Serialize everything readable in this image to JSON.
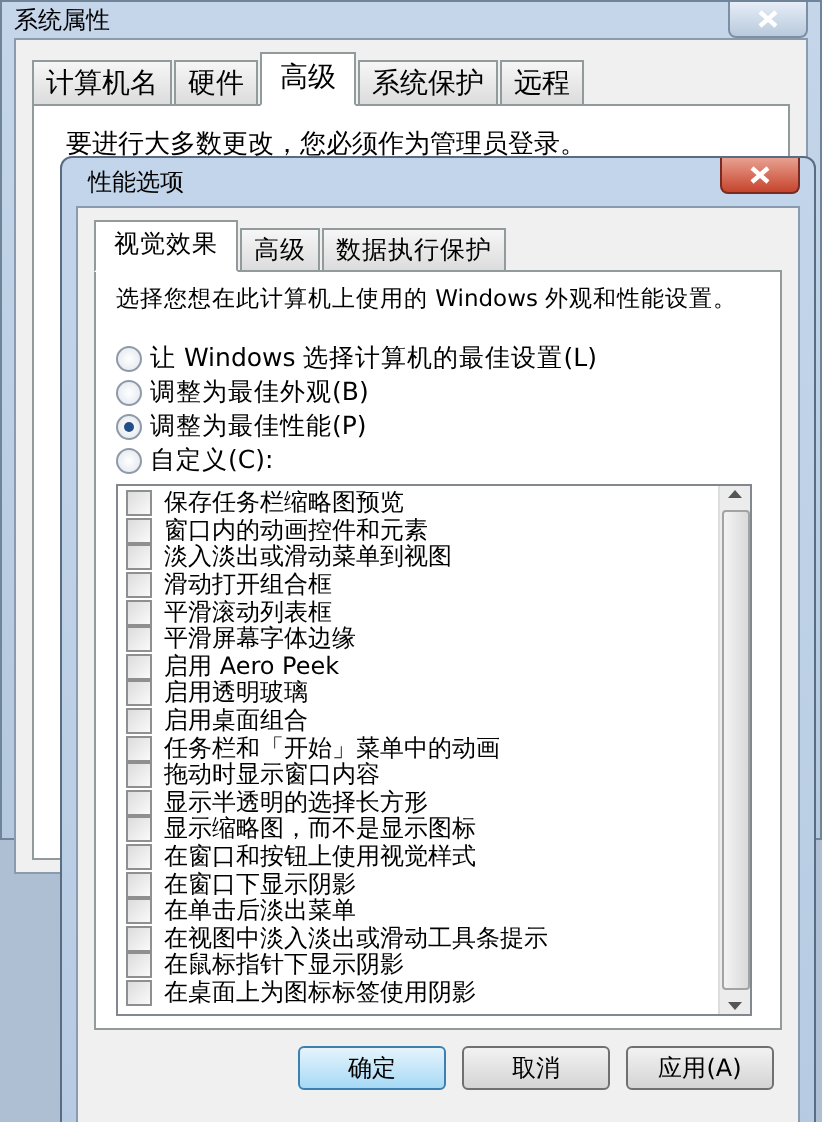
{
  "back_window": {
    "title": "系统属性",
    "tabs": [
      {
        "label": "计算机名",
        "selected": false
      },
      {
        "label": "硬件",
        "selected": false
      },
      {
        "label": "高级",
        "selected": true
      },
      {
        "label": "系统保护",
        "selected": false
      },
      {
        "label": "远程",
        "selected": false
      }
    ],
    "notice": "要进行大多数更改，您必须作为管理员登录。"
  },
  "dialog": {
    "title": "性能选项",
    "tabs": [
      {
        "label": "视觉效果",
        "selected": true
      },
      {
        "label": "高级",
        "selected": false
      },
      {
        "label": "数据执行保护",
        "selected": false
      }
    ],
    "description": "选择您想在此计算机上使用的 Windows 外观和性能设置。",
    "options": [
      {
        "label": "让 Windows 选择计算机的最佳设置(L)",
        "selected": false
      },
      {
        "label": "调整为最佳外观(B)",
        "selected": false
      },
      {
        "label": "调整为最佳性能(P)",
        "selected": true
      },
      {
        "label": "自定义(C):",
        "selected": false
      }
    ],
    "effects": [
      {
        "label": "保存任务栏缩略图预览",
        "checked": false
      },
      {
        "label": "窗口内的动画控件和元素",
        "checked": false
      },
      {
        "label": "淡入淡出或滑动菜单到视图",
        "checked": false
      },
      {
        "label": "滑动打开组合框",
        "checked": false
      },
      {
        "label": "平滑滚动列表框",
        "checked": false
      },
      {
        "label": "平滑屏幕字体边缘",
        "checked": false
      },
      {
        "label": "启用 Aero Peek",
        "checked": false
      },
      {
        "label": "启用透明玻璃",
        "checked": false
      },
      {
        "label": "启用桌面组合",
        "checked": false
      },
      {
        "label": "任务栏和「开始」菜单中的动画",
        "checked": false
      },
      {
        "label": "拖动时显示窗口内容",
        "checked": false
      },
      {
        "label": "显示半透明的选择长方形",
        "checked": false
      },
      {
        "label": "显示缩略图，而不是显示图标",
        "checked": false
      },
      {
        "label": "在窗口和按钮上使用视觉样式",
        "checked": false
      },
      {
        "label": "在窗口下显示阴影",
        "checked": false
      },
      {
        "label": "在单击后淡出菜单",
        "checked": false
      },
      {
        "label": "在视图中淡入淡出或滑动工具条提示",
        "checked": false
      },
      {
        "label": "在鼠标指针下显示阴影",
        "checked": false
      },
      {
        "label": "在桌面上为图标标签使用阴影",
        "checked": false
      }
    ],
    "buttons": [
      {
        "label": "确定",
        "default": true
      },
      {
        "label": "取消",
        "default": false
      },
      {
        "label": "应用(A)",
        "default": false
      }
    ]
  }
}
